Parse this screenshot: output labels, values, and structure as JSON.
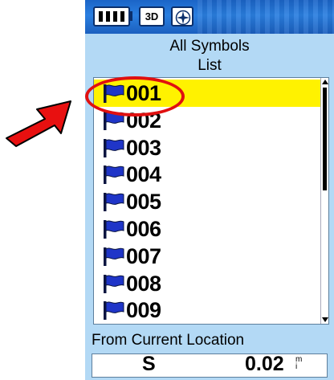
{
  "header": {
    "line1": "All Symbols",
    "line2": "List"
  },
  "status_bar": {
    "icons": [
      "battery-icon",
      "gps-3d-icon",
      "compass-icon"
    ],
    "gps_mode_label": "3D"
  },
  "list": {
    "selected_index": 0,
    "items": [
      {
        "label": "001",
        "icon": "blue-flag-icon"
      },
      {
        "label": "002",
        "icon": "blue-flag-icon"
      },
      {
        "label": "003",
        "icon": "blue-flag-icon"
      },
      {
        "label": "004",
        "icon": "blue-flag-icon"
      },
      {
        "label": "005",
        "icon": "blue-flag-icon"
      },
      {
        "label": "006",
        "icon": "blue-flag-icon"
      },
      {
        "label": "007",
        "icon": "blue-flag-icon"
      },
      {
        "label": "008",
        "icon": "blue-flag-icon"
      },
      {
        "label": "009",
        "icon": "blue-flag-icon"
      }
    ]
  },
  "footer": {
    "label": "From Current Location",
    "direction": "S",
    "distance": "0.02",
    "distance_unit": "m\ni"
  },
  "colors": {
    "screen_bg": "#b3d9f5",
    "selection": "#fff200",
    "flag": "#1f35c8",
    "annotation": "#e01010"
  }
}
